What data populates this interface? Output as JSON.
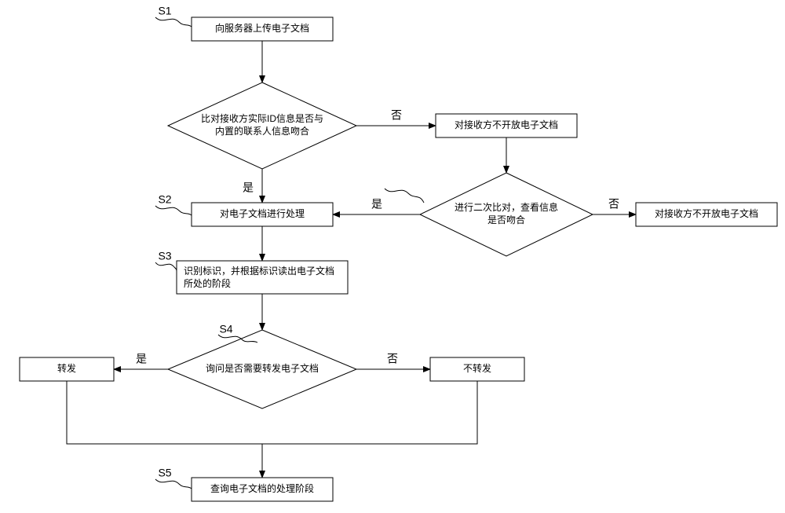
{
  "chart_data": {
    "type": "flowchart",
    "title": "",
    "nodes": [
      {
        "id": "s1",
        "step": "S1",
        "shape": "rect",
        "text": "向服务器上传电子文档"
      },
      {
        "id": "d1",
        "shape": "diamond",
        "text": "比对接收方实际ID信息是否与内置的联系人信息吻合"
      },
      {
        "id": "b_noopen1",
        "shape": "rect",
        "text": "对接收方不开放电子文档"
      },
      {
        "id": "d2",
        "shape": "diamond",
        "text": "进行二次比对，查看信息是否吻合"
      },
      {
        "id": "b_noopen2",
        "shape": "rect",
        "text": "对接收方不开放电子文档"
      },
      {
        "id": "s2",
        "step": "S2",
        "shape": "rect",
        "text": "对电子文档进行处理"
      },
      {
        "id": "s3",
        "step": "S3",
        "shape": "rect",
        "text": "识别标识，并根据标识读出电子文档所处的阶段"
      },
      {
        "id": "d3",
        "step": "S4",
        "shape": "diamond",
        "text": "询问是否需要转发电子文档"
      },
      {
        "id": "b_forward",
        "shape": "rect",
        "text": "转发"
      },
      {
        "id": "b_noforward",
        "shape": "rect",
        "text": "不转发"
      },
      {
        "id": "s5",
        "step": "S5",
        "shape": "rect",
        "text": "查询电子文档的处理阶段"
      }
    ],
    "edges": [
      {
        "from": "s1",
        "to": "d1"
      },
      {
        "from": "d1",
        "to": "s2",
        "label": "是"
      },
      {
        "from": "d1",
        "to": "b_noopen1",
        "label": "否"
      },
      {
        "from": "b_noopen1",
        "to": "d2"
      },
      {
        "from": "d2",
        "to": "s2",
        "label": "是"
      },
      {
        "from": "d2",
        "to": "b_noopen2",
        "label": "否"
      },
      {
        "from": "s2",
        "to": "s3"
      },
      {
        "from": "s3",
        "to": "d3"
      },
      {
        "from": "d3",
        "to": "b_forward",
        "label": "是"
      },
      {
        "from": "d3",
        "to": "b_noforward",
        "label": "否"
      },
      {
        "from": "b_forward",
        "to": "s5"
      },
      {
        "from": "b_noforward",
        "to": "s5"
      }
    ]
  },
  "steps": {
    "s1": "S1",
    "s2": "S2",
    "s3": "S3",
    "s4": "S4",
    "s5": "S5"
  },
  "labels": {
    "yes": "是",
    "no": "否"
  },
  "text": {
    "upload": "向服务器上传电子文档",
    "d1a": "比对接收方实际ID信息是否与",
    "d1b": "内置的联系人信息吻合",
    "noopen": "对接收方不开放电子文档",
    "d2a": "进行二次比对，查看信息",
    "d2b": "是否吻合",
    "process": "对电子文档进行处理",
    "s3a": "识别标识，并根据标识读出电子文档",
    "s3b": "所处的阶段",
    "d3": "询问是否需要转发电子文档",
    "forward": "转发",
    "noforward": "不转发",
    "query": "查询电子文档的处理阶段"
  }
}
